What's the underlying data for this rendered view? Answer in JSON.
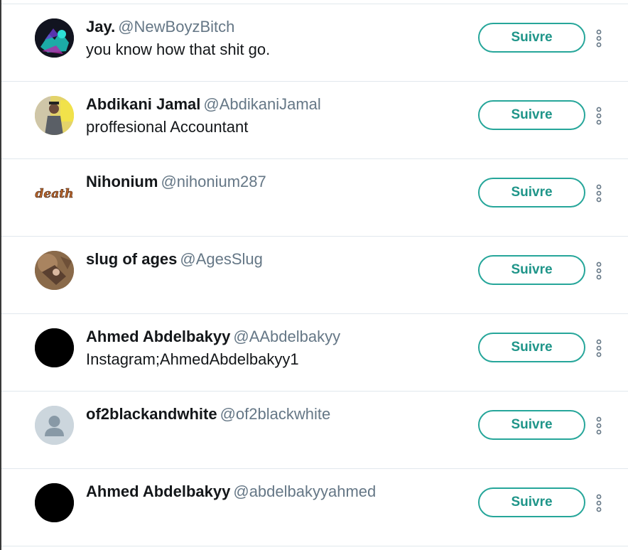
{
  "colors": {
    "accent": "#26a69a",
    "name": "#14171a",
    "handle": "#657786",
    "divider": "#e1e8ed"
  },
  "follow_label": "Suivre",
  "users": [
    {
      "name": "Jay.",
      "handle": "@NewBoyzBitch",
      "bio": "you know how that shit go.",
      "avatar": "photo-dark-neon"
    },
    {
      "name": "Abdikani Jamal",
      "handle": "@AbdikaniJamal",
      "bio": "proffesional Accountant",
      "avatar": "photo-graduation"
    },
    {
      "name": "Nihonium",
      "handle": "@nihonium287",
      "bio": "",
      "avatar": "death-text-image"
    },
    {
      "name": "slug of ages",
      "handle": "@AgesSlug",
      "bio": "",
      "avatar": "photo-brown"
    },
    {
      "name": "Ahmed Abdelbakyy",
      "handle": "@AAbdelbakyy",
      "bio": "Instagram;AhmedAbdelbakyy1",
      "avatar": "black-circle"
    },
    {
      "name": "of2blackandwhite",
      "handle": "@of2blackwhite",
      "bio": "",
      "avatar": "default-profile-icon"
    },
    {
      "name": "Ahmed Abdelbakyy",
      "handle": "@abdelbakyyahmed",
      "bio": "",
      "avatar": "black-circle"
    }
  ]
}
